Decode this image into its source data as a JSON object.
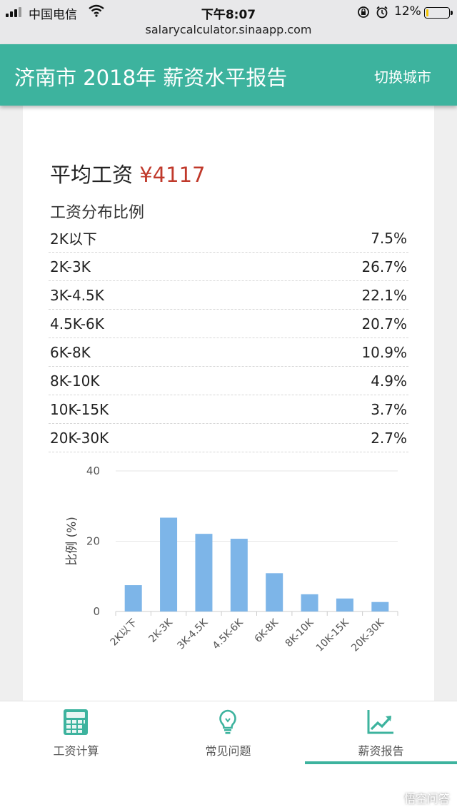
{
  "status_bar": {
    "carrier": "中国电信",
    "time": "下午8:07",
    "battery": "12%",
    "battery_level": 0.12,
    "url": "salarycalculator.sinaapp.com"
  },
  "header": {
    "title": "济南市 2018年 薪资水平报告",
    "switch_city": "切换城市",
    "accent_color": "#3db39e"
  },
  "report": {
    "avg_label": "平均工资",
    "avg_value": "¥4117",
    "dist_title": "工资分布比例",
    "rows": [
      {
        "range": "2K以下",
        "pct": "7.5%"
      },
      {
        "range": "2K-3K",
        "pct": "26.7%"
      },
      {
        "range": "3K-4.5K",
        "pct": "22.1%"
      },
      {
        "range": "4.5K-6K",
        "pct": "20.7%"
      },
      {
        "range": "6K-8K",
        "pct": "10.9%"
      },
      {
        "range": "8K-10K",
        "pct": "4.9%"
      },
      {
        "range": "10K-15K",
        "pct": "3.7%"
      },
      {
        "range": "20K-30K",
        "pct": "2.7%"
      }
    ]
  },
  "chart_data": {
    "type": "bar",
    "categories": [
      "2K以下",
      "2K-3K",
      "3K-4.5K",
      "4.5K-6K",
      "6K-8K",
      "8K-10K",
      "10K-15K",
      "20K-30K"
    ],
    "values": [
      7.5,
      26.7,
      22.1,
      20.7,
      10.9,
      4.9,
      3.7,
      2.7
    ],
    "ylabel": "比例 (%)",
    "ylim": [
      0,
      40
    ],
    "yticks": [
      "0",
      "20",
      "40"
    ],
    "grid": true,
    "bar_color": "#7db5e8"
  },
  "tabs": [
    {
      "label": "工资计算",
      "icon": "calculator-icon"
    },
    {
      "label": "常见问题",
      "icon": "lightbulb-icon"
    },
    {
      "label": "薪资报告",
      "icon": "trend-chart-icon",
      "active": true
    }
  ],
  "watermark": "悟空问答"
}
